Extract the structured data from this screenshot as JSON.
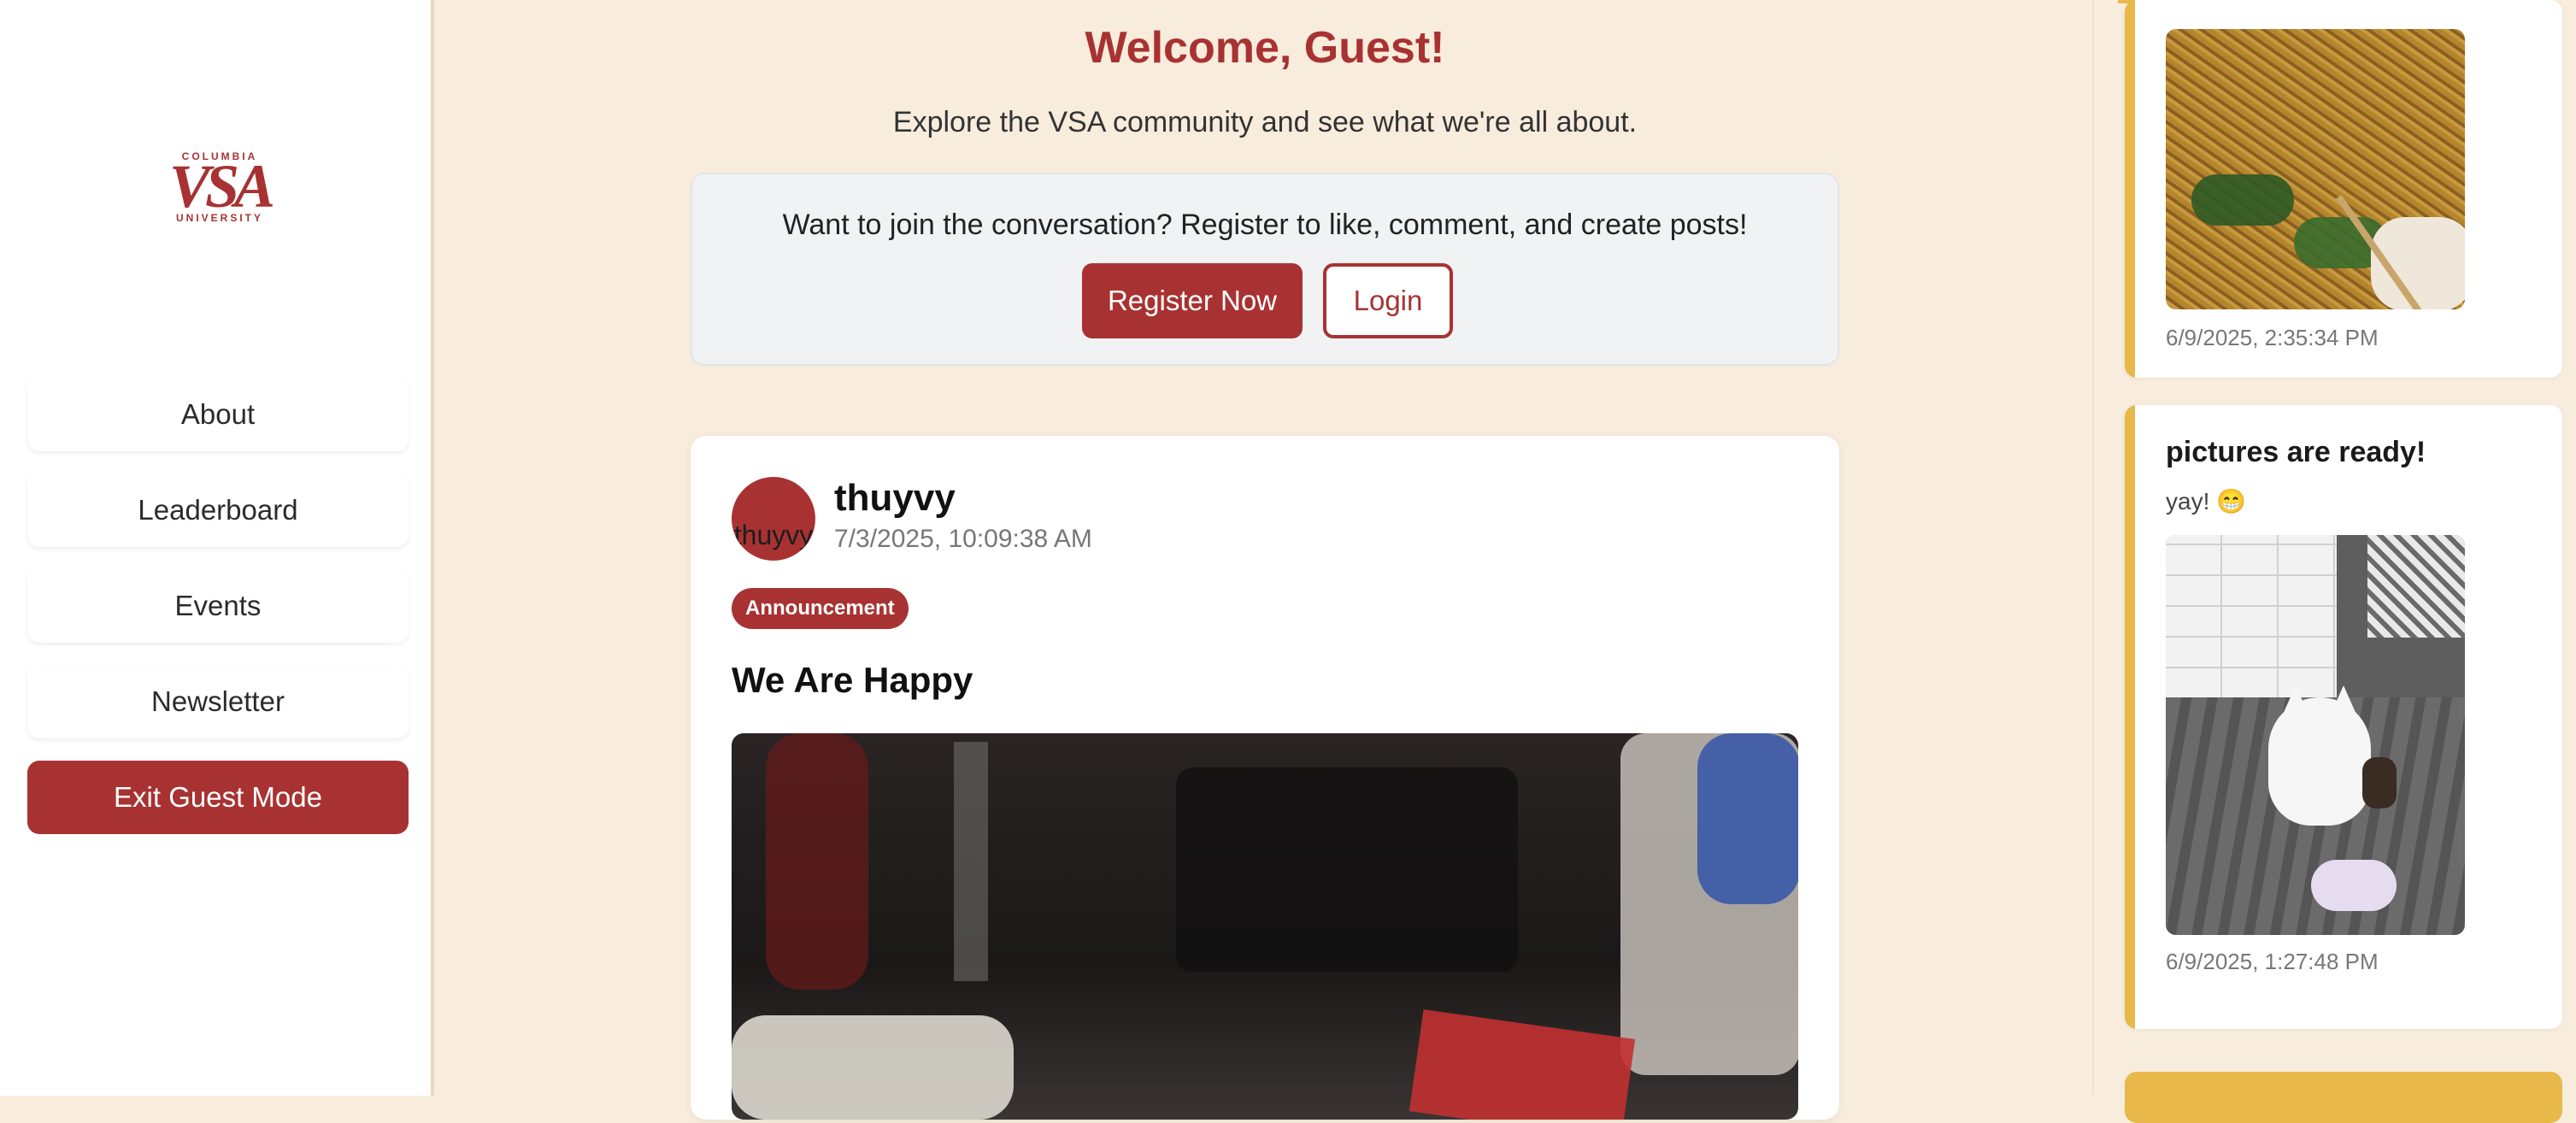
{
  "sidebar": {
    "logo": {
      "top_text": "COLUMBIA",
      "main_text": "VSA",
      "bottom_text": "UNIVERSITY"
    },
    "items": [
      {
        "label": "About"
      },
      {
        "label": "Leaderboard"
      },
      {
        "label": "Events"
      },
      {
        "label": "Newsletter"
      }
    ],
    "exit_label": "Exit Guest Mode"
  },
  "main": {
    "welcome": "Welcome, Guest!",
    "subtitle": "Explore the VSA community and see what we're all about.",
    "join": {
      "text": "Want to join the conversation? Register to like, comment, and create posts!",
      "register_label": "Register Now",
      "login_label": "Login"
    },
    "post": {
      "avatar_alt": "thuyvy",
      "username": "thuyvy",
      "timestamp": "7/3/2025, 10:09:38 AM",
      "tag": "Announcement",
      "title": "We Are Happy"
    }
  },
  "feed": {
    "cards": [
      {
        "timestamp": "6/9/2025, 2:35:34 PM"
      },
      {
        "title": "pictures are ready!",
        "body": "yay! 😁",
        "timestamp": "6/9/2025, 1:27:48 PM"
      }
    ]
  },
  "colors": {
    "brand": "#a83232",
    "accent": "#e8b84a",
    "background": "#f8ecdc"
  }
}
